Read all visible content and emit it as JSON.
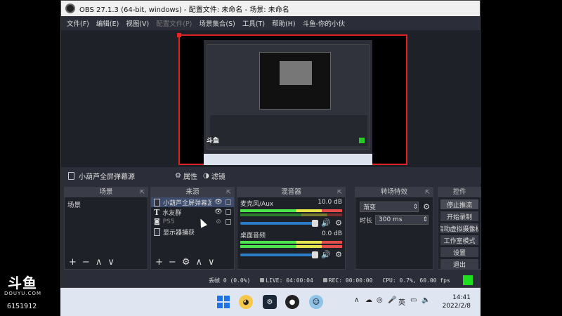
{
  "stream": {
    "logo_text": "斗鱼",
    "logo_sub": "DOUYU.COM",
    "room_id": "6151912"
  },
  "window": {
    "title": "OBS 27.1.3 (64-bit, windows) - 配置文件: 未命名 - 场景: 未命名"
  },
  "menu": {
    "items": [
      "文件(F)",
      "编辑(E)",
      "视图(V)",
      "配置文件(P)",
      "场景集合(S)",
      "工具(T)",
      "帮助(H)",
      "斗鱼-你的小伙"
    ]
  },
  "source_toolbar": {
    "selected_source": "小葫芦全屏弹幕源",
    "properties": "属性",
    "filters": "滤镜"
  },
  "scenes": {
    "title": "场景",
    "items": [
      "场景"
    ],
    "footer": [
      "+",
      "−",
      "∧",
      "∨"
    ]
  },
  "sources": {
    "title": "来源",
    "items": [
      {
        "name": "小葫芦全屏弹幕源",
        "visible": true,
        "selected": true
      },
      {
        "name": "水友群",
        "visible": true,
        "selected": false
      },
      {
        "name": "PS5",
        "visible": false,
        "selected": false
      },
      {
        "name": "显示器捕获",
        "visible": true,
        "selected": false
      }
    ],
    "footer": [
      "+",
      "−",
      "⚙",
      "∧",
      "∨"
    ]
  },
  "mixer": {
    "title": "混音器",
    "tracks": [
      {
        "name": "麦克风/Aux",
        "db": "10.0 dB"
      },
      {
        "name": "桌面音频",
        "db": "0.0 dB"
      }
    ]
  },
  "transitions": {
    "title": "转场特效",
    "selected": "渐变",
    "duration_label": "时长",
    "duration_value": "300 ms"
  },
  "controls": {
    "title": "控件",
    "buttons": [
      "停止推流",
      "开始录制",
      "启动虚拟摄像机",
      "工作室模式",
      "设置",
      "退出"
    ]
  },
  "status": {
    "dropped": "丢帧 0 (0.0%)",
    "live": "LIVE: 04:00:04",
    "rec": "REC: 00:00:00",
    "cpu": "CPU: 0.7%, 60.00 fps",
    "indicator_color": "#1ddf1d"
  },
  "taskbar": {
    "lang": "英",
    "time": "14:41",
    "date": "2022/2/8"
  }
}
